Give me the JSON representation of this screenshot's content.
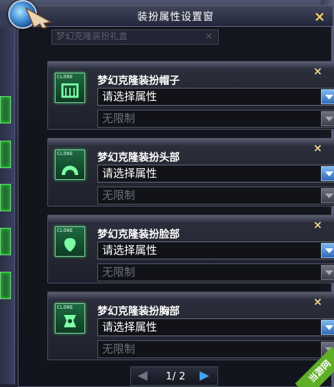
{
  "window": {
    "title": "装扮属性设置窗",
    "close_symbol": "×",
    "ghost_tab_label": "梦幻克隆装扮礼盒",
    "ghost_tab_close": "×"
  },
  "cards": [
    {
      "title": "梦幻克隆装扮帽子",
      "icon_tag": "CLONE",
      "icon_name": "clone-hat-icon",
      "close_symbol": "×",
      "attribute_select": "请选择属性",
      "limit_select": "无限制"
    },
    {
      "title": "梦幻克隆装扮头部",
      "icon_tag": "CLONE",
      "icon_name": "clone-hair-icon",
      "close_symbol": "×",
      "attribute_select": "请选择属性",
      "limit_select": "无限制"
    },
    {
      "title": "梦幻克隆装扮脸部",
      "icon_tag": "CLONE",
      "icon_name": "clone-face-icon",
      "close_symbol": "×",
      "attribute_select": "请选择属性",
      "limit_select": "无限制"
    },
    {
      "title": "梦幻克隆装扮胸部",
      "icon_tag": "CLONE",
      "icon_name": "clone-chest-icon",
      "close_symbol": "×",
      "attribute_select": "请选择属性",
      "limit_select": "无限制"
    }
  ],
  "pagination": {
    "current": "1/ 2",
    "prev_icon": "triangle-left-icon",
    "next_icon": "triangle-right-icon"
  },
  "watermark": {
    "text": "当游网"
  },
  "colors": {
    "title_close": "#f2cf6a",
    "select_arrow_blue": "#2f6ab8",
    "icon_green": "#38c96a",
    "watermark_green": "#5fae27"
  }
}
